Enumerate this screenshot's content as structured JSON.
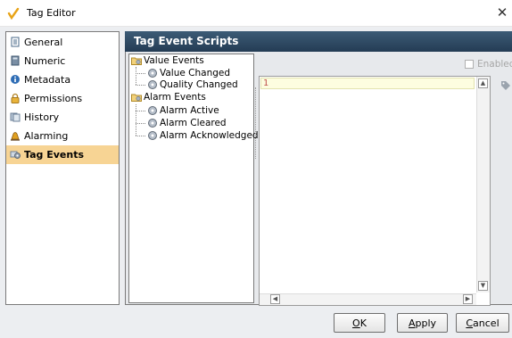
{
  "window": {
    "title": "Tag Editor",
    "close_glyph": "✕"
  },
  "nav": {
    "items": [
      {
        "label": "General",
        "icon": "document-icon",
        "selected": false
      },
      {
        "label": "Numeric",
        "icon": "numeric-icon",
        "selected": false
      },
      {
        "label": "Metadata",
        "icon": "info-icon",
        "selected": false
      },
      {
        "label": "Permissions",
        "icon": "lock-icon",
        "selected": false
      },
      {
        "label": "History",
        "icon": "history-icon",
        "selected": false
      },
      {
        "label": "Alarming",
        "icon": "bell-icon",
        "selected": false
      },
      {
        "label": "Tag Events",
        "icon": "tag-events-icon",
        "selected": true
      }
    ]
  },
  "section": {
    "title": "Tag Event Scripts"
  },
  "tree": {
    "groups": [
      {
        "label": "Value Events",
        "children": [
          "Value Changed",
          "Quality Changed"
        ]
      },
      {
        "label": "Alarm Events",
        "children": [
          "Alarm Active",
          "Alarm Cleared",
          "Alarm Acknowledged"
        ]
      }
    ]
  },
  "editor": {
    "enabled_label": "Enabled",
    "enabled_checked": false,
    "line_number": "1"
  },
  "scroll": {
    "up": "▲",
    "down": "▼",
    "left": "◀",
    "right": "▶"
  },
  "buttons": {
    "ok": {
      "label": "OK",
      "mnemonic": "O"
    },
    "apply": {
      "label": "Apply",
      "mnemonic": "A"
    },
    "cancel": {
      "label": "Cancel",
      "mnemonic": "C"
    }
  },
  "colors": {
    "header_bg": "#2c4863",
    "selected_nav_bg": "#f7d494",
    "line_number": "#c0504d",
    "disabled_text": "#a6a6a6"
  }
}
